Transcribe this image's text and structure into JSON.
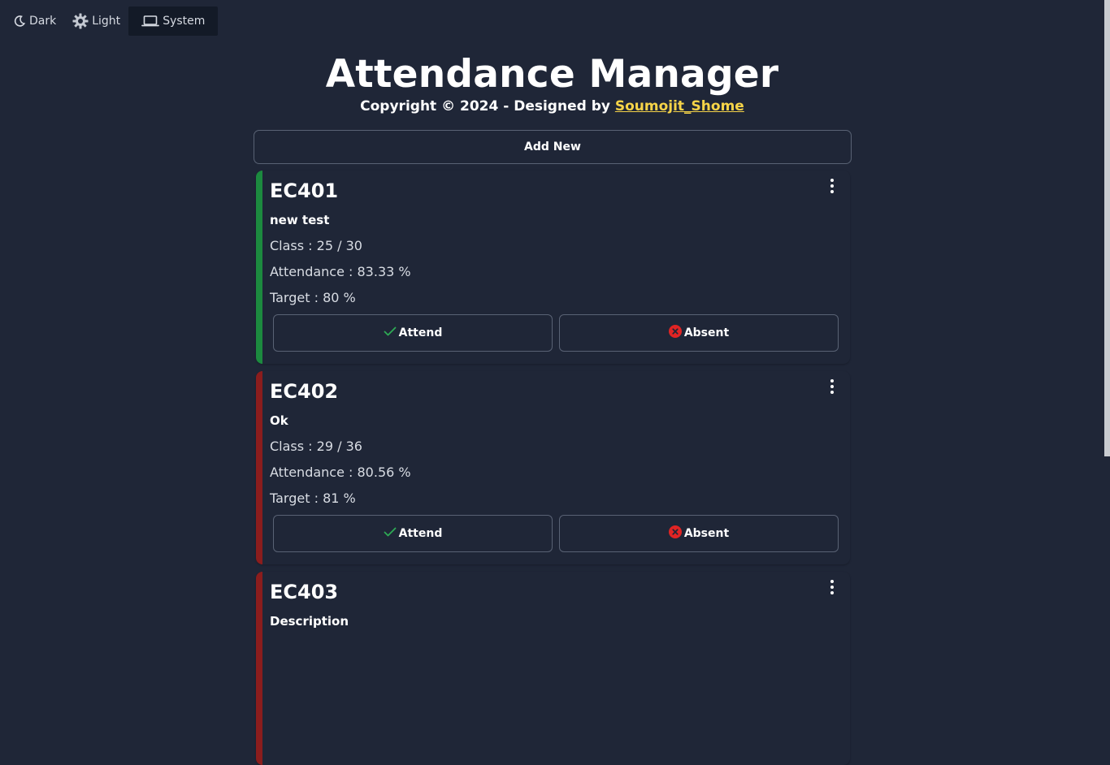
{
  "theme": {
    "options": [
      {
        "label": "Dark",
        "icon": "moon-icon"
      },
      {
        "label": "Light",
        "icon": "gear-sun-icon"
      },
      {
        "label": "System",
        "icon": "laptop-icon"
      }
    ],
    "selected": "System"
  },
  "header": {
    "title": "Attendance Manager",
    "copyright_prefix": "Copyright © 2024 - Designed by ",
    "author": "Soumojit_Shome"
  },
  "add_new_label": "Add New",
  "colors": {
    "background": "#1f2637",
    "above_target": "#1c8a3f",
    "below_target": "#8b1d1d",
    "author_link": "#f6d448",
    "attend_check": "#2eaa55",
    "absent_icon": "#e02424"
  },
  "cards": [
    {
      "code": "EC401",
      "description": "new test",
      "class_text": "Class : 25 / 30",
      "attendance_text": "Attendance : 83.33 %",
      "target_text": "Target : 80 %",
      "status": "above",
      "attend_label": "Attend",
      "absent_label": "Absent"
    },
    {
      "code": "EC402",
      "description": "Ok",
      "class_text": "Class : 29 / 36",
      "attendance_text": "Attendance : 80.56 %",
      "target_text": "Target : 81 %",
      "status": "below",
      "attend_label": "Attend",
      "absent_label": "Absent"
    },
    {
      "code": "EC403",
      "description": "Description",
      "status": "below"
    }
  ]
}
